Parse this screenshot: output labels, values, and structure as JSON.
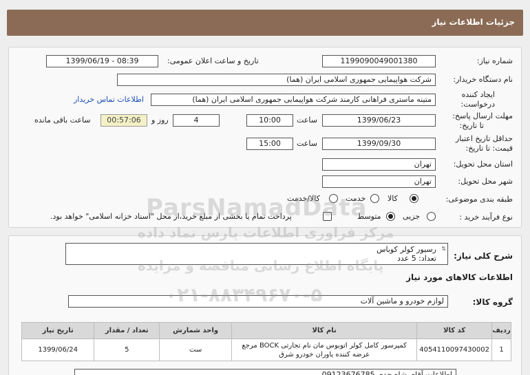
{
  "page": {
    "title": "جزئیات اطلاعات نیاز"
  },
  "info": {
    "need_number_label": "شماره نیاز:",
    "need_number": "1199090049001380",
    "announce_label": "تاریخ و ساعت اعلان عمومی:",
    "announce_value": "1399/06/19 - 08:39",
    "buyer_label": "نام دستگاه خریدار:",
    "buyer_value": "شرکت هواپیمایی جمهوری اسلامی ایران (هما)",
    "creator_label_1": "ایجاد کننده",
    "creator_label_2": "درخواست:",
    "creator_value": "متینه ماستری فراهانی کارمند شرکت هواپیمایی جمهوری اسلامی ایران (هما)",
    "contact_link": "اطلاعات تماس خریدار",
    "reply_label_1": "مهلت ارسال پاسخ:",
    "reply_label_2": "تا تاریخ:",
    "reply_date": "1399/06/23",
    "time_label": "ساعت",
    "reply_time": "10:00",
    "days_value": "4",
    "days_label": "روز و",
    "remaining_time": "00:57:06",
    "remaining_label": "ساعت باقی مانده",
    "validity_label_1": "حداقل تاریخ اعتبار",
    "validity_label_2": "قیمت: تا تاریخ:",
    "validity_date": "1399/09/30",
    "validity_time": "15:00",
    "province_label": "استان محل تحویل:",
    "province_value": "تهران",
    "city_label": "شهر محل تحویل:",
    "city_value": "تهران",
    "category_label": "طبقه بندی موضوعی:",
    "category_options": [
      "کالا",
      "خدمت",
      "کالا/خدمت"
    ],
    "category_selected": "کالا",
    "process_label": "نوع فرآیند خرید :",
    "process_options": [
      "جزیی",
      "متوسط"
    ],
    "process_selected": "متوسط",
    "payment_note": "پرداخت تمام یا بخشی از مبلغ خرید،از محل \"اسناد خزانه اسلامی\" خواهد بود."
  },
  "details": {
    "summary_label": "شرح کلی نیاز:",
    "summary_line1": "رسیور کولر کوباس",
    "summary_line2": "تعداد: 5 عدد",
    "goods_info_title": "اطلاعات کالاهای مورد نیاز",
    "group_label": "گروه کالا:",
    "group_value": "لوازم خودرو و ماشین آلات",
    "table": {
      "headers": [
        "ردیف",
        "کد کالا",
        "نام کالا",
        "واحد شمارش",
        "تعداد / مقدار",
        "تاریخ نیاز"
      ],
      "rows": [
        {
          "row": "1",
          "code": "4054110097430002",
          "name_line1": "کمپرسور کامل کولر اتوبوس مان نام تجارتی BOCK مرجع",
          "name_line2": "عرضه کننده یاوران خودرو شرق",
          "unit": "ست",
          "qty": "5",
          "date": "1399/06/24"
        }
      ]
    },
    "bottom_note": "اطلاعات آقای شاه حدی 09123676785"
  },
  "watermark": {
    "brand": "ParsNamadData",
    "line1": "مرکز فراوری اطلاعات پارس نماد داده",
    "line2": "پایگاه اطلاع رسانی مناقصه و مزایده",
    "phone": "۰۲۱-۸۸۳۴۹۶۷۰-۵"
  }
}
